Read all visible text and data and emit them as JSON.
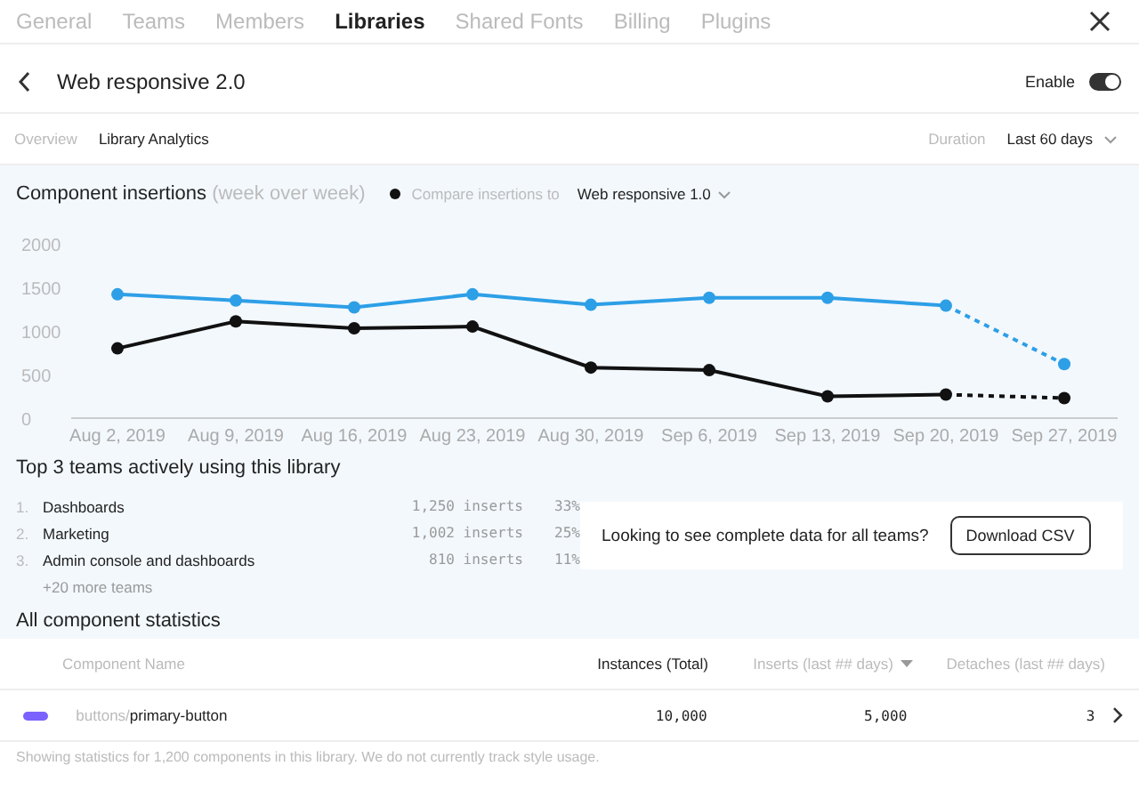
{
  "tabs": [
    {
      "label": "General",
      "selected": false
    },
    {
      "label": "Teams",
      "selected": false
    },
    {
      "label": "Members",
      "selected": false
    },
    {
      "label": "Libraries",
      "selected": true
    },
    {
      "label": "Shared Fonts",
      "selected": false
    },
    {
      "label": "Billing",
      "selected": false
    },
    {
      "label": "Plugins",
      "selected": false
    }
  ],
  "header": {
    "title": "Web responsive 2.0",
    "toggle_label": "Enable",
    "enabled": true
  },
  "subnav": [
    {
      "label": "Overview",
      "selected": false
    },
    {
      "label": "Library Analytics",
      "selected": true
    }
  ],
  "duration": {
    "label": "Duration",
    "value": "Last 60 days"
  },
  "insertions": {
    "title": "Component insertions",
    "subtitle": "(week over week)",
    "compare_label": "Compare insertions to",
    "compare_value": "Web responsive 1.0",
    "chart_data": {
      "type": "line",
      "categories": [
        "Aug 2, 2019",
        "Aug 9, 2019",
        "Aug 16, 2019",
        "Aug 23, 2019",
        "Aug 30, 2019",
        "Sep 6, 2019",
        "Sep 13, 2019",
        "Sep 20, 2019",
        "Sep 27, 2019"
      ],
      "ylim": [
        0,
        2000
      ],
      "yticks": [
        0,
        500,
        1000,
        1500,
        2000
      ],
      "series": [
        {
          "color": "#2d9fe6",
          "marker": "circle",
          "values": [
            1420,
            1350,
            1270,
            1420,
            1300,
            1380,
            1380,
            1290,
            620
          ]
        },
        {
          "color": "#111111",
          "marker": "circle",
          "values": [
            800,
            1110,
            1030,
            1050,
            580,
            550,
            250,
            270,
            230
          ]
        }
      ]
    }
  },
  "top_teams": {
    "title": "Top 3 teams actively using this library",
    "teams": [
      {
        "rank": "1.",
        "name": "Dashboards",
        "inserts": "1,250 inserts",
        "share": "33%"
      },
      {
        "rank": "2.",
        "name": "Marketing",
        "inserts": "1,002 inserts",
        "share": "25%"
      },
      {
        "rank": "3.",
        "name": "Admin console and dashboards",
        "inserts": "810 inserts",
        "share": "11%"
      }
    ],
    "more": "+20 more teams",
    "cta_text": "Looking to see complete data for all teams?",
    "cta_button": "Download CSV"
  },
  "stats": {
    "title": "All component statistics",
    "columns": [
      "Component Name",
      "Instances (Total)",
      "Inserts (last ## days)",
      "Detaches (last ## days)"
    ],
    "rows": [
      {
        "path": "buttons/",
        "name": "primary-button",
        "instances": "10,000",
        "inserts": "5,000",
        "detaches": "3"
      }
    ],
    "footer": "Showing statistics for 1,200 components in this library. We do not currently track style usage."
  }
}
